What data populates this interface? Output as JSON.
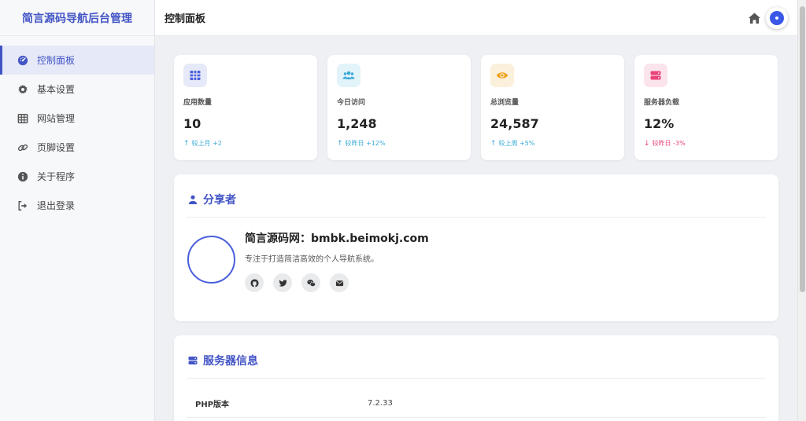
{
  "brand": {
    "title": "简言源码导航后台管理"
  },
  "sidebar": {
    "items": [
      {
        "label": "控制面板",
        "icon": "dashboard-icon",
        "active": true
      },
      {
        "label": "基本设置",
        "icon": "gear-icon"
      },
      {
        "label": "网站管理",
        "icon": "grid-icon"
      },
      {
        "label": "页脚设置",
        "icon": "link-icon"
      },
      {
        "label": "关于程序",
        "icon": "info-icon"
      },
      {
        "label": "退出登录",
        "icon": "logout-icon"
      }
    ]
  },
  "header": {
    "title": "控制面板",
    "home_icon": "home-icon",
    "avatar_icon": "avatar-icon"
  },
  "stats": [
    {
      "label": "应用数量",
      "value": "10",
      "trend": "较上月 +2",
      "direction": "up",
      "icon": "grid-icon",
      "icon_color": "#4a5fdc",
      "icon_bg": "#e6e9f8"
    },
    {
      "label": "今日访问",
      "value": "1,248",
      "trend": "较昨日 +12%",
      "direction": "up",
      "icon": "users-icon",
      "icon_color": "#38a9d6",
      "icon_bg": "#e3f3fa"
    },
    {
      "label": "总浏览量",
      "value": "24,587",
      "trend": "较上周 +5%",
      "direction": "up",
      "icon": "eye-icon",
      "icon_color": "#f0a21b",
      "icon_bg": "#fbf0dc"
    },
    {
      "label": "服务器负载",
      "value": "12%",
      "trend": "较昨日 -3%",
      "direction": "down",
      "icon": "server-icon",
      "icon_color": "#e9437a",
      "icon_bg": "#fce4ec"
    }
  ],
  "sharer": {
    "title": "分享者",
    "name": "简言源码网：bmbk.beimokj.com",
    "description": "专注于打造简洁高效的个人导航系统。",
    "socials": [
      "github-icon",
      "twitter-icon",
      "wechat-icon",
      "email-icon"
    ]
  },
  "server": {
    "title": "服务器信息",
    "rows": [
      {
        "key": "PHP版本",
        "value": "7.2.33"
      }
    ]
  },
  "colors": {
    "accent": "#4254c5",
    "up": "#38a9d6",
    "down": "#e9437a"
  }
}
